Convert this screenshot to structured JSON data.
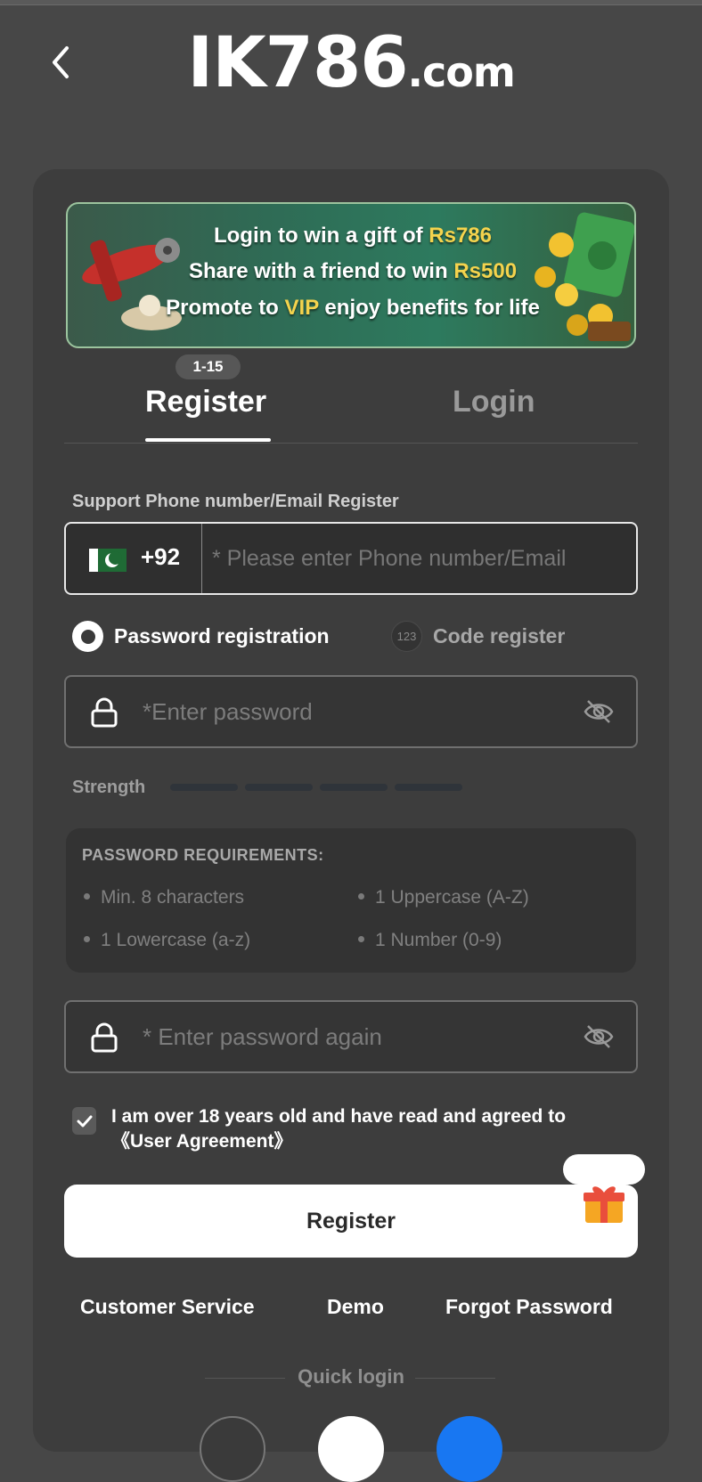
{
  "header": {
    "back_icon": "chevron-left-icon",
    "logo_main": "IK786",
    "logo_tld": ".com"
  },
  "banner": {
    "line1_prefix": "Login to win a gift of ",
    "line1_highlight": "Rs786",
    "line2_prefix": "Share with a friend to win ",
    "line2_highlight": "Rs500",
    "line3_prefix": "Promote to ",
    "line3_highlight": "VIP",
    "line3_suffix": " enjoy benefits for life"
  },
  "tabs": {
    "badge": "1-15",
    "register": "Register",
    "login": "Login",
    "active": "register"
  },
  "phone": {
    "label": "Support Phone number/Email Register",
    "country_flag": "pakistan-flag-icon",
    "country_code": "+92",
    "placeholder": "* Please enter Phone number/Email",
    "value": ""
  },
  "registration_mode": {
    "password_option": "Password registration",
    "code_option": "Code register",
    "code_icon_text": "123",
    "selected": "password"
  },
  "password": {
    "placeholder": "*Enter password",
    "confirm_placeholder": "* Enter password again",
    "strength_label": "Strength",
    "strength_level": 0
  },
  "requirements": {
    "title": "PASSWORD REQUIREMENTS:",
    "items": [
      "Min. 8 characters",
      "1 Uppercase (A-Z)",
      "1 Lowercase (a-z)",
      "1 Number (0-9)"
    ]
  },
  "agreement": {
    "checked": true,
    "text": "I am over 18 years old and have read and agreed to",
    "link": "《User Agreement》"
  },
  "actions": {
    "register_button": "Register",
    "customer_service": "Customer Service",
    "demo": "Demo",
    "forgot_password": "Forgot Password",
    "quick_login": "Quick login"
  },
  "colors": {
    "background": "#474747",
    "card": "#3d3d3d",
    "accent_gold": "#f4d34d",
    "text_muted": "#9a9a9a"
  }
}
